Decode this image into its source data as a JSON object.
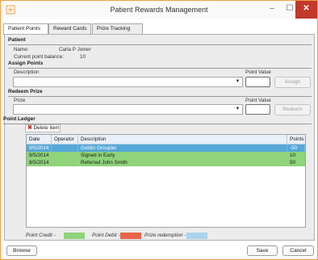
{
  "window": {
    "title": "Patient Rewards Management",
    "minimize_glyph": "–",
    "maximize_glyph": "☐",
    "close_glyph": "✕"
  },
  "tabs": [
    {
      "label": "Patient Points",
      "active": true
    },
    {
      "label": "Reward Cards",
      "active": false
    },
    {
      "label": "Prize Tracking",
      "active": false
    }
  ],
  "patient": {
    "section_title": "Patient",
    "name_label": "Name:",
    "name_value": "Carla P Joiner",
    "balance_label": "Current point balance:",
    "balance_value": "10"
  },
  "assign_points": {
    "section_title": "Assign Points",
    "description_label": "Description",
    "point_value_label": "Point Value",
    "description_value": "",
    "point_value": "",
    "assign_label": "Assign"
  },
  "redeem_prize": {
    "section_title": "Redeem Prize",
    "prize_label": "Prize",
    "point_value_label": "Point Value",
    "prize_value": "",
    "point_value": "",
    "redeem_label": "Redeem"
  },
  "ledger": {
    "section_title": "Point Ledger",
    "delete_label": "Delete item",
    "columns": [
      "Date",
      "Operator",
      "Description",
      "Points"
    ],
    "rows": [
      {
        "date": "9/5/2014",
        "operator": "",
        "description": "Goblin Grouplet",
        "points": "-50",
        "type": "debit",
        "selected": true
      },
      {
        "date": "9/5/2014",
        "operator": "",
        "description": "Signed in Early",
        "points": "10",
        "type": "credit",
        "selected": false
      },
      {
        "date": "8/5/2014",
        "operator": "",
        "description": "Referred John Smith",
        "points": "50",
        "type": "credit",
        "selected": false
      }
    ]
  },
  "legend": {
    "credit_label": "Point Credit -",
    "debit_label": "Point Debit -",
    "redemption_label": "Prize redemption -",
    "credit_color": "#8fd37a",
    "debit_color": "#e8644a",
    "redemption_color": "#a8d4ec"
  },
  "footer": {
    "browse_label": "Browse",
    "save_label": "Save",
    "cancel_label": "Cancel"
  },
  "colors": {
    "accent_border": "#f0a040",
    "close_button": "#c0392b",
    "selected_row": "#55a8d8"
  }
}
